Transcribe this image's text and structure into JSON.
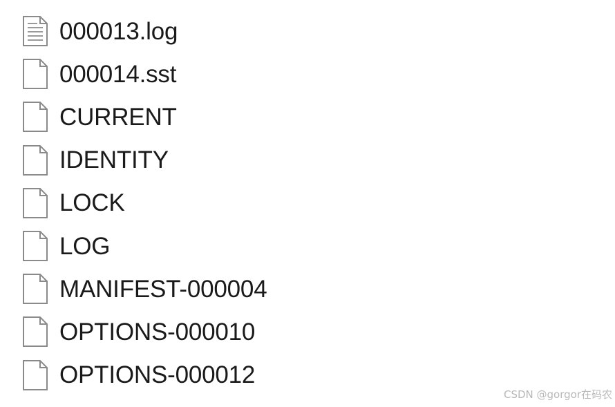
{
  "files": [
    {
      "name": "000013.log",
      "icon": "text-document-icon"
    },
    {
      "name": "000014.sst",
      "icon": "blank-document-icon"
    },
    {
      "name": "CURRENT",
      "icon": "blank-document-icon"
    },
    {
      "name": "IDENTITY",
      "icon": "blank-document-icon"
    },
    {
      "name": "LOCK",
      "icon": "blank-document-icon"
    },
    {
      "name": "LOG",
      "icon": "blank-document-icon"
    },
    {
      "name": "MANIFEST-000004",
      "icon": "blank-document-icon"
    },
    {
      "name": "OPTIONS-000010",
      "icon": "blank-document-icon"
    },
    {
      "name": "OPTIONS-000012",
      "icon": "blank-document-icon"
    }
  ],
  "watermark": "CSDN @gorgor在码农",
  "colors": {
    "text": "#1a1a1a",
    "icon_outline": "#8a8a8a",
    "icon_fill": "#ffffff",
    "icon_lines": "#9a9a9a",
    "watermark": "#b8b8b8"
  }
}
